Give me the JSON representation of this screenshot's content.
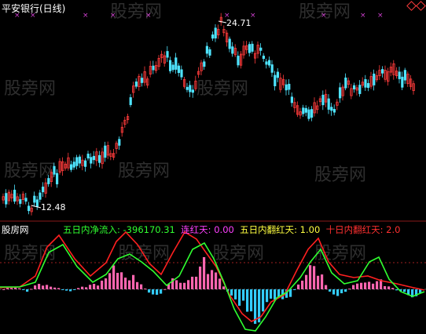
{
  "header": {
    "title": "平安银行(日线)"
  },
  "price_labels": {
    "high": "24.71",
    "low": "12.48"
  },
  "indicator": {
    "name": "股房网",
    "items": [
      {
        "label": "五日内净流入: ",
        "value": "-396170.31",
        "label_color": "#30ff30",
        "value_color": "#30ff30"
      },
      {
        "label": "  连红天: ",
        "value": "0.00",
        "label_color": "#ff40ff",
        "value_color": "#ff40ff"
      },
      {
        "label": "  五日内翻红天: ",
        "value": "1.00",
        "label_color": "#ffff40",
        "value_color": "#ffff40"
      },
      {
        "label": "  十日内翻红天: ",
        "value": "2.0",
        "label_color": "#ff3030",
        "value_color": "#ff3030"
      }
    ]
  },
  "colors": {
    "up_candle": "#ff3b3b",
    "down_candle": "#4fe4ff",
    "marker": "#d040d0",
    "hist_pos": "#ff66b0",
    "hist_neg": "#33ccff",
    "line_red": "#ff2020",
    "line_green": "#30ff30"
  },
  "watermark": "股旁网",
  "icons": [
    "diamond-icon",
    "diamond-icon"
  ]
}
